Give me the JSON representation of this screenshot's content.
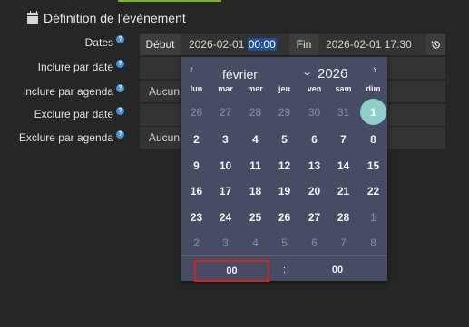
{
  "section": {
    "title": "Définition de l'évènement",
    "icon": "calendar-icon"
  },
  "form": {
    "help_glyph": "?",
    "rows": [
      {
        "label": "Dates"
      },
      {
        "label": "Inclure par date"
      },
      {
        "label": "Inclure par agenda",
        "value": "Aucun"
      },
      {
        "label": "Exclure par date"
      },
      {
        "label": "Exclure par agenda",
        "value": "Aucun"
      }
    ],
    "dates": {
      "start_label": "Début",
      "start_date": "2026-02-01",
      "start_time": "00:00",
      "end_label": "Fin",
      "end_value": "2026-02-01 17:30",
      "reset_icon": "history-icon"
    }
  },
  "datepicker": {
    "prev": "‹",
    "next": "›",
    "month": "février",
    "year_chevron": "⌄",
    "year": "2026",
    "weekdays": [
      "lun",
      "mar",
      "mer",
      "jeu",
      "ven",
      "sam",
      "dim"
    ],
    "weeks": [
      [
        {
          "d": "26",
          "o": true
        },
        {
          "d": "27",
          "o": true
        },
        {
          "d": "28",
          "o": true
        },
        {
          "d": "29",
          "o": true
        },
        {
          "d": "30",
          "o": true
        },
        {
          "d": "31",
          "o": true
        },
        {
          "d": "1",
          "t": true
        }
      ],
      [
        {
          "d": "2"
        },
        {
          "d": "3"
        },
        {
          "d": "4"
        },
        {
          "d": "5"
        },
        {
          "d": "6"
        },
        {
          "d": "7"
        },
        {
          "d": "8"
        }
      ],
      [
        {
          "d": "9"
        },
        {
          "d": "10"
        },
        {
          "d": "11"
        },
        {
          "d": "12"
        },
        {
          "d": "13"
        },
        {
          "d": "14"
        },
        {
          "d": "15"
        }
      ],
      [
        {
          "d": "16"
        },
        {
          "d": "17"
        },
        {
          "d": "18"
        },
        {
          "d": "19"
        },
        {
          "d": "20"
        },
        {
          "d": "21"
        },
        {
          "d": "22"
        }
      ],
      [
        {
          "d": "23"
        },
        {
          "d": "24"
        },
        {
          "d": "25"
        },
        {
          "d": "26"
        },
        {
          "d": "27"
        },
        {
          "d": "28"
        },
        {
          "d": "1",
          "o": true
        }
      ],
      [
        {
          "d": "2",
          "o": true
        },
        {
          "d": "3",
          "o": true
        },
        {
          "d": "4",
          "o": true
        },
        {
          "d": "5",
          "o": true
        },
        {
          "d": "6",
          "o": true
        },
        {
          "d": "7",
          "o": true
        },
        {
          "d": "8",
          "o": true
        }
      ]
    ],
    "time": {
      "hours": "00",
      "separator": ":",
      "minutes": "00"
    }
  },
  "colors": {
    "accent_green": "#7ab41e",
    "today": "#8ed0c9",
    "picker_bg": "#454c63",
    "highlight_border": "#d62020"
  }
}
